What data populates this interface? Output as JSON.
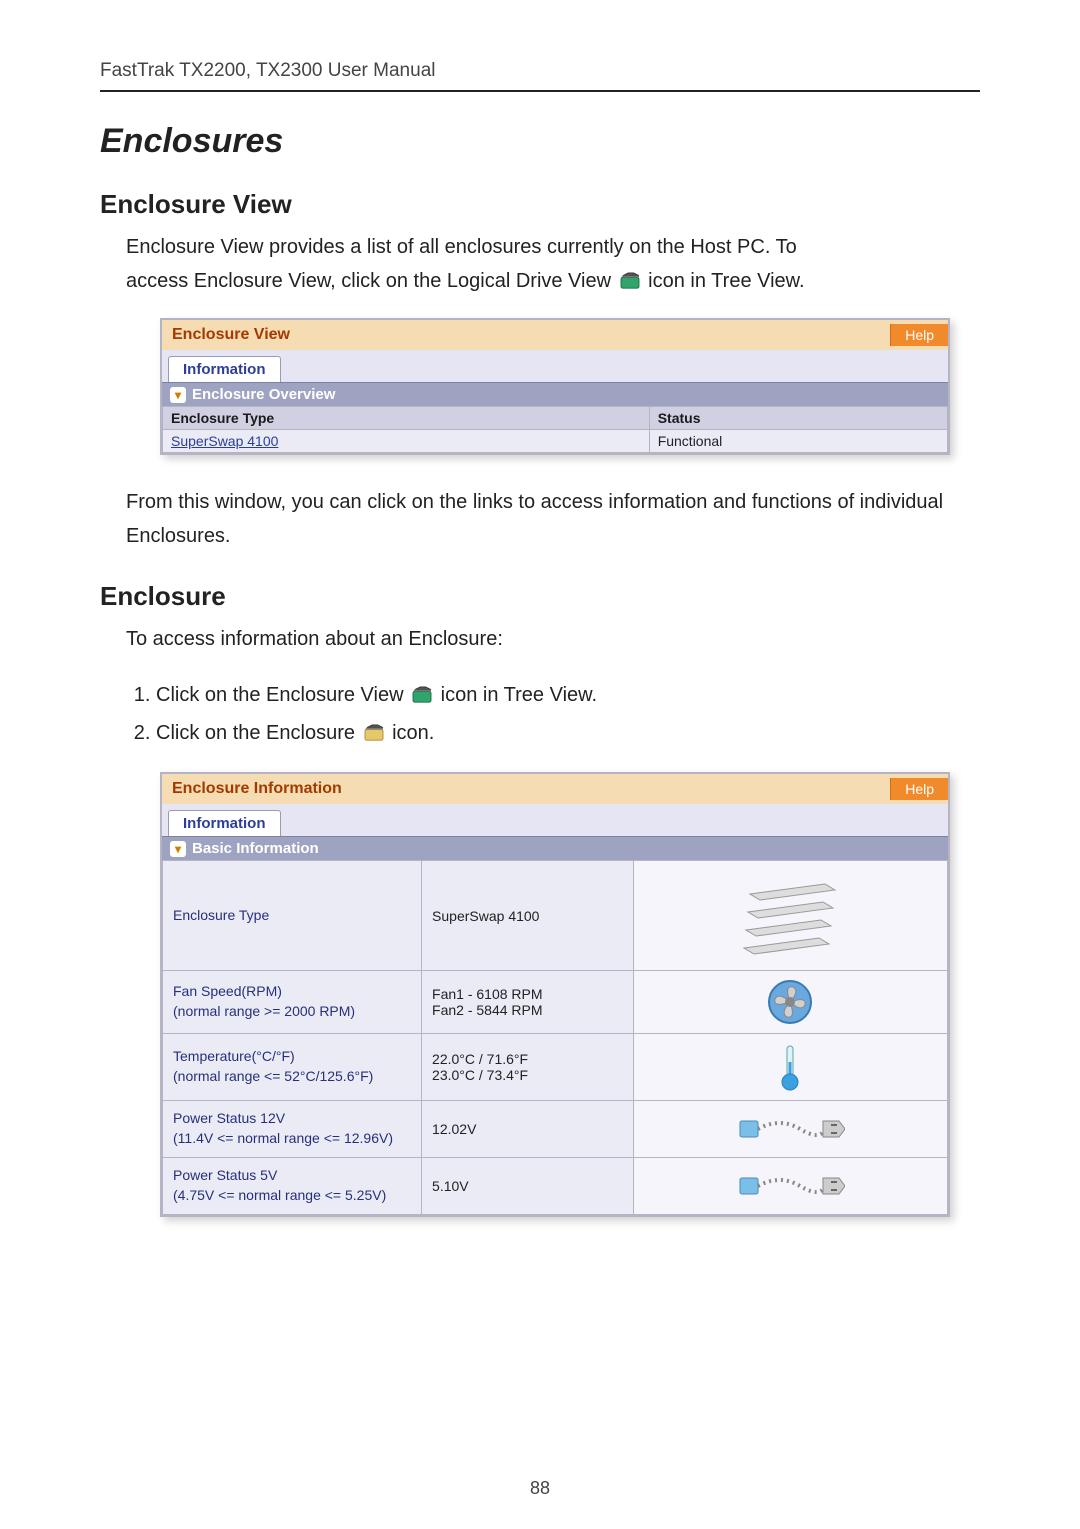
{
  "header": {
    "manual_title": "FastTrak TX2200, TX2300 User Manual"
  },
  "section": {
    "title": "Enclosures",
    "view_heading": "Enclosure View",
    "view_para1a": "Enclosure View provides a list of all enclosures currently on the Host PC. To",
    "view_para1b_a": "access Enclosure View, click on the Logical Drive View ",
    "view_para1b_b": " icon in Tree View.",
    "view_para2": "From this window, you can click on the links to access information and functions of individual Enclosures.",
    "encl_heading": "Enclosure",
    "encl_para": "To access information about an Enclosure:",
    "step1a": "Click on the Enclosure View ",
    "step1b": " icon in Tree View.",
    "step2a": "Click on the Enclosure ",
    "step2b": " icon."
  },
  "panel1": {
    "title": "Enclosure View",
    "help": "Help",
    "tab": "Information",
    "section": "Enclosure Overview",
    "col_type": "Enclosure Type",
    "col_status": "Status",
    "row_link": "SuperSwap 4100",
    "row_status": "Functional"
  },
  "panel2": {
    "title": "Enclosure Information",
    "help": "Help",
    "tab": "Information",
    "section": "Basic Information",
    "rows": {
      "type_lbl": "Enclosure Type",
      "type_val": "SuperSwap 4100",
      "fan_lbl_a": "Fan Speed(RPM)",
      "fan_lbl_b": "(normal range >= 2000 RPM)",
      "fan_val_a": "Fan1 - 6108 RPM",
      "fan_val_b": "Fan2 - 5844 RPM",
      "temp_lbl_a": "Temperature(°C/°F)",
      "temp_lbl_b": "(normal range <= 52°C/125.6°F)",
      "temp_val_a": "22.0°C / 71.6°F",
      "temp_val_b": "23.0°C / 73.4°F",
      "p12_lbl_a": "Power Status 12V",
      "p12_lbl_b": "(11.4V <= normal range <= 12.96V)",
      "p12_val": "12.02V",
      "p5_lbl_a": "Power Status 5V",
      "p5_lbl_b": "(4.75V <= normal range <= 5.25V)",
      "p5_val": "5.10V"
    }
  },
  "footer": {
    "page": "88"
  }
}
